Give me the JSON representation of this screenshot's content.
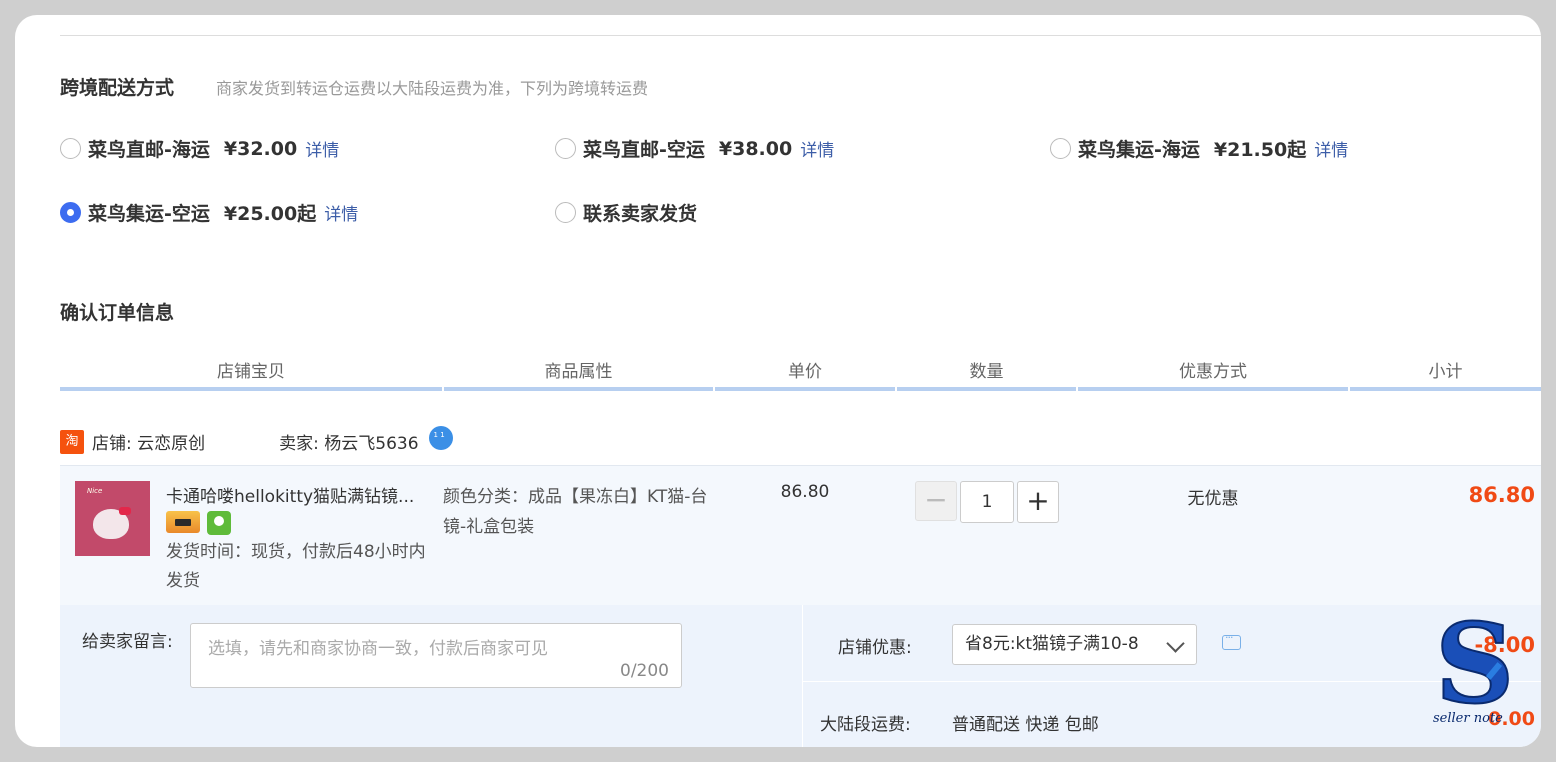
{
  "shipping": {
    "title": "跨境配送方式",
    "note": "商家发货到转运仓运费以大陆段运费为准，下列为跨境转运费",
    "options": [
      {
        "name": "菜鸟直邮-海运",
        "price": "¥32.00",
        "link": "详情",
        "selected": false
      },
      {
        "name": "菜鸟直邮-空运",
        "price": "¥38.00",
        "link": "详情",
        "selected": false
      },
      {
        "name": "菜鸟集运-海运",
        "price": "¥21.50起",
        "link": "详情",
        "selected": false
      },
      {
        "name": "菜鸟集运-空运",
        "price": "¥25.00起",
        "link": "详情",
        "selected": true
      },
      {
        "name": "联系卖家发货",
        "price": "",
        "link": "",
        "selected": false
      }
    ]
  },
  "order": {
    "title": "确认订单信息",
    "headers": [
      "店铺宝贝",
      "商品属性",
      "单价",
      "数量",
      "优惠方式",
      "小计"
    ],
    "shop": {
      "icon_text": "淘",
      "shop_label": "店铺: 云恋原创",
      "seller_label": "卖家: 杨云飞5636"
    },
    "item": {
      "title": "卡通哈喽hellokitty猫贴满钻镜...",
      "ship_time": "发货时间：现货，付款后48小时内发货",
      "attr": "颜色分类：成品【果冻白】KT猫-台镜-礼盒包装",
      "unit_price": "86.80",
      "quantity": "1",
      "minus": "−",
      "plus": "+",
      "promo": "无优惠",
      "subtotal": "86.80"
    },
    "message": {
      "label": "给卖家留言:",
      "placeholder": "选填，请先和商家协商一致，付款后商家可见",
      "count": "0/200"
    },
    "coupon": {
      "label": "店铺优惠:",
      "selected": "省8元:kt猫镜子满10-8",
      "amount": "-8.00"
    },
    "mainland_fee": {
      "label": "大陆段运费:",
      "value": "普通配送 快递 包邮",
      "amount": "0.00"
    }
  },
  "watermark": {
    "letter": "S",
    "caption": "seller note"
  }
}
